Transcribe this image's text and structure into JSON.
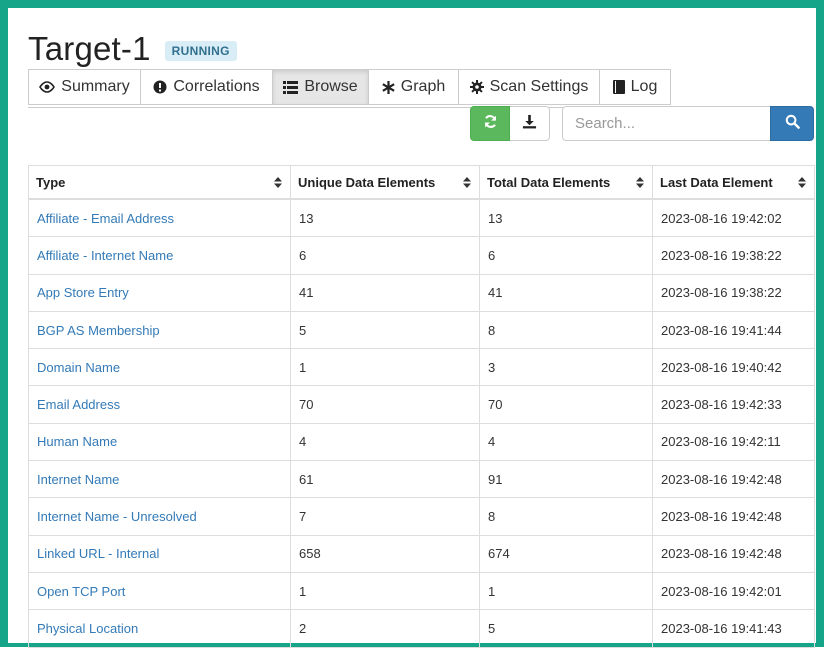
{
  "header": {
    "title": "Target-1",
    "status": "RUNNING"
  },
  "tabs": [
    {
      "label": "Summary",
      "icon": "eye-icon",
      "active": false
    },
    {
      "label": "Correlations",
      "icon": "exclamation-circle-icon",
      "active": false
    },
    {
      "label": "Browse",
      "icon": "list-icon",
      "active": true
    },
    {
      "label": "Graph",
      "icon": "asterisk-icon",
      "active": false
    },
    {
      "label": "Scan Settings",
      "icon": "gear-icon",
      "active": false
    },
    {
      "label": "Log",
      "icon": "book-icon",
      "active": false
    }
  ],
  "toolbar": {
    "refresh_icon": "refresh-icon",
    "download_icon": "download-icon",
    "search_placeholder": "Search...",
    "search_icon": "search-icon"
  },
  "colors": {
    "frame": "#17a589",
    "accent": "#337ab7",
    "refresh": "#5cb85c",
    "badge_bg": "#d9edf7"
  },
  "table": {
    "columns": [
      "Type",
      "Unique Data Elements",
      "Total Data Elements",
      "Last Data Element"
    ],
    "rows": [
      [
        "Affiliate - Email Address",
        "13",
        "13",
        "2023-08-16 19:42:02"
      ],
      [
        "Affiliate - Internet Name",
        "6",
        "6",
        "2023-08-16 19:38:22"
      ],
      [
        "App Store Entry",
        "41",
        "41",
        "2023-08-16 19:38:22"
      ],
      [
        "BGP AS Membership",
        "5",
        "8",
        "2023-08-16 19:41:44"
      ],
      [
        "Domain Name",
        "1",
        "3",
        "2023-08-16 19:40:42"
      ],
      [
        "Email Address",
        "70",
        "70",
        "2023-08-16 19:42:33"
      ],
      [
        "Human Name",
        "4",
        "4",
        "2023-08-16 19:42:11"
      ],
      [
        "Internet Name",
        "61",
        "91",
        "2023-08-16 19:42:48"
      ],
      [
        "Internet Name - Unresolved",
        "7",
        "8",
        "2023-08-16 19:42:48"
      ],
      [
        "Linked URL - Internal",
        "658",
        "674",
        "2023-08-16 19:42:48"
      ],
      [
        "Open TCP Port",
        "1",
        "1",
        "2023-08-16 19:42:01"
      ],
      [
        "Physical Location",
        "2",
        "5",
        "2023-08-16 19:41:43"
      ]
    ]
  }
}
